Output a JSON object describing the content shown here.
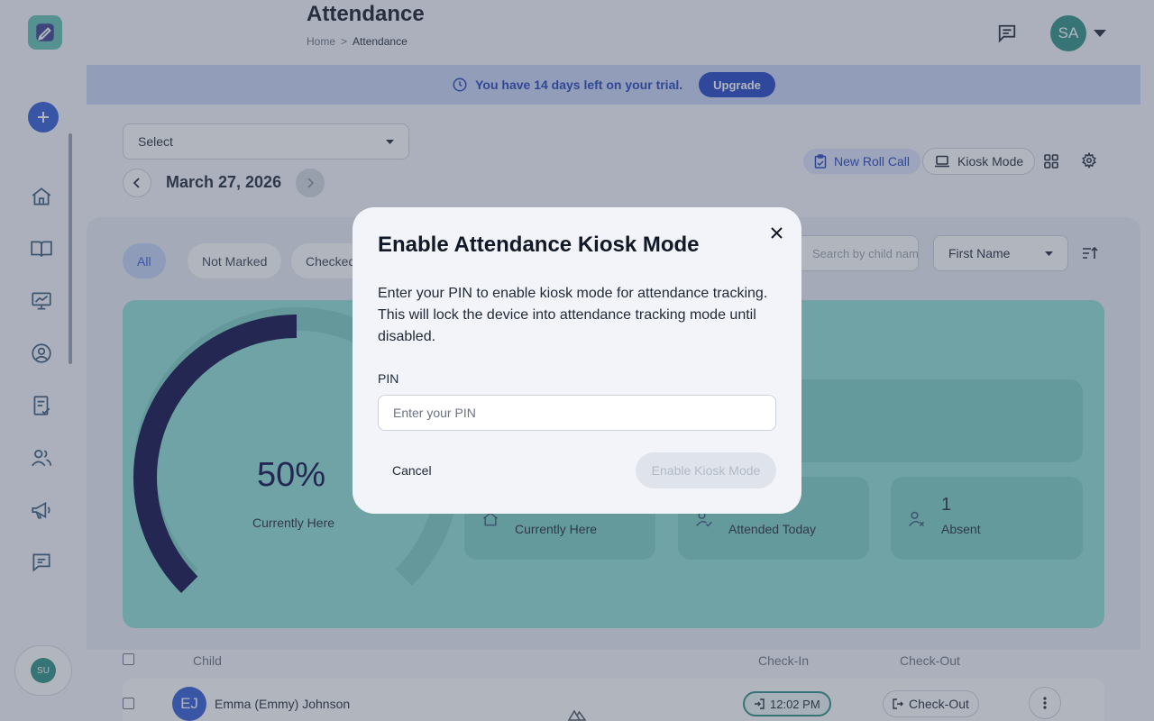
{
  "header": {
    "title": "Attendance",
    "breadcrumb": {
      "home": "Home",
      "separator": ">",
      "current": "Attendance"
    },
    "avatar_initials": "SA"
  },
  "trial_banner": {
    "text": "You have 14 days left on your trial.",
    "upgrade_label": "Upgrade"
  },
  "sidebar": {
    "nav": [
      {
        "name": "home-icon"
      },
      {
        "name": "book-icon"
      },
      {
        "name": "presentation-icon"
      },
      {
        "name": "user-circle-icon"
      },
      {
        "name": "clipboard-check-icon"
      },
      {
        "name": "users-icon"
      },
      {
        "name": "megaphone-icon"
      },
      {
        "name": "message-icon"
      }
    ],
    "user_initials": "SU"
  },
  "controls": {
    "select_label": "Select",
    "date": "March 27, 2026",
    "new_roll_call": "New Roll Call",
    "kiosk_mode": "Kiosk Mode"
  },
  "filters": {
    "chips": [
      "All",
      "Not Marked",
      "Checked"
    ],
    "search_placeholder": "Search by child name...",
    "sort_value": "First Name"
  },
  "stats": {
    "percent": "50%",
    "percent_value": 0.5,
    "percent_label": "Currently Here",
    "cards": [
      {
        "label": "Currently Here",
        "icon": "home-icon"
      },
      {
        "label": "Attended Today",
        "icon": "user-check-icon"
      },
      {
        "number": "1",
        "label": "Absent",
        "icon": "user-x-icon"
      }
    ]
  },
  "table": {
    "headers": {
      "child": "Child",
      "check_in": "Check-In",
      "check_out": "Check-Out"
    },
    "rows": [
      {
        "initials": "EJ",
        "name": "Emma (Emmy) Johnson",
        "check_in": "12:02 PM",
        "check_out": "Check-Out"
      }
    ]
  },
  "modal": {
    "title": "Enable Attendance Kiosk Mode",
    "description": "Enter your PIN to enable kiosk mode for attendance tracking. This will lock the device into attendance tracking mode until disabled.",
    "pin_label": "PIN",
    "pin_placeholder": "Enter your PIN",
    "pin_value": "",
    "cancel_label": "Cancel",
    "enable_label": "Enable Kiosk Mode"
  },
  "colors": {
    "primary": "#2f5bd6",
    "teal": "#2e8f83",
    "gauge_dark": "#0c0b45"
  }
}
